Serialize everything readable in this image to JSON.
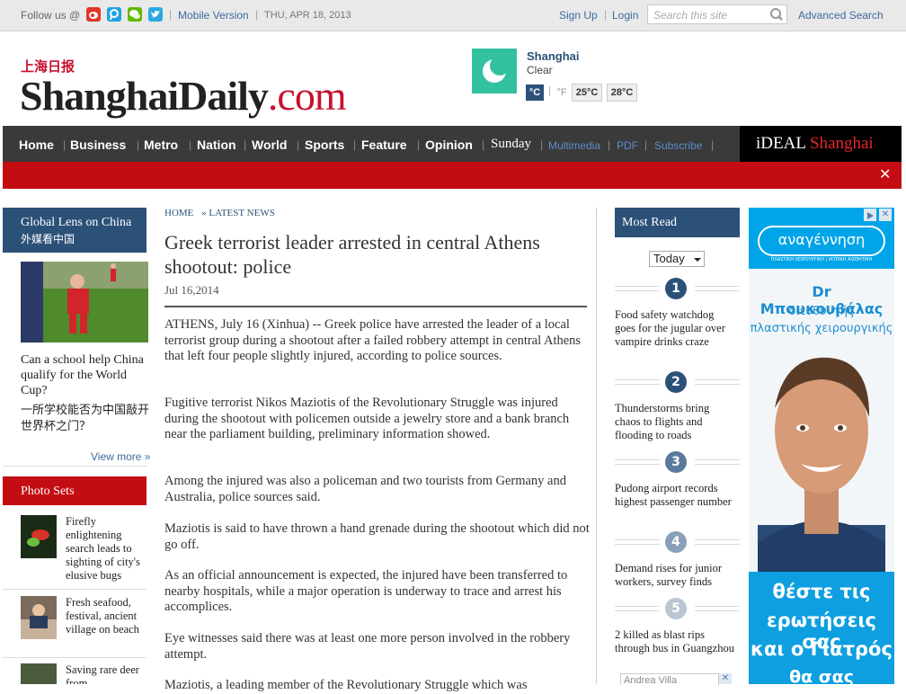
{
  "topbar": {
    "follow_label": "Follow us @",
    "social_icons": [
      {
        "name": "weibo-icon",
        "color": "#e0352b"
      },
      {
        "name": "tencent-weibo-icon",
        "color": "#1fa3e5"
      },
      {
        "name": "wechat-icon",
        "color": "#62b900"
      },
      {
        "name": "twitter-icon",
        "color": "#2aa9e0"
      }
    ],
    "mobile_version": "Mobile Version",
    "date": "THU, APR 18, 2013",
    "sign_up": "Sign Up",
    "login": "Login",
    "search_placeholder": "Search this site",
    "advanced_search": "Advanced Search"
  },
  "header": {
    "logo_cn": "上海日报",
    "logo_main": "ShanghaiDaily",
    "logo_suffix": ".com",
    "weather": {
      "city": "Shanghai",
      "condition": "Clear",
      "unit_c": "°C",
      "unit_f": "°F",
      "temp_low": "25°C",
      "temp_high": "28°C"
    }
  },
  "nav": {
    "items": [
      "Home",
      "Business",
      "Metro",
      "Nation",
      "World",
      "Sports",
      "Feature",
      "Opinion",
      "Sunday"
    ],
    "small_items": [
      "Multimedia",
      "PDF",
      "Subscribe"
    ],
    "promo_ideal": "iDEAL",
    "promo_shanghai": "Shanghai",
    "close_symbol": "✕"
  },
  "left": {
    "global_lens_title_en": "Global Lens on China",
    "global_lens_title_cn": "外媒看中国",
    "global_lens_headline": "Can a school help China qualify for the World Cup?",
    "global_lens_headline_cn": "一所学校能否为中国敲开世界杯之门？",
    "view_more": "View more »",
    "photo_sets_title": "Photo Sets",
    "photo_sets": [
      "Firefly enlightening search leads to sighting of city's elusive bugs",
      "Fresh seafood, festival, ancient village on beach",
      "Saving rare deer from"
    ]
  },
  "article": {
    "breadcrumb_home": "HOME",
    "breadcrumb_sep": "»",
    "breadcrumb_section": "LATEST NEWS",
    "title": "Greek terrorist leader arrested in central Athens shootout: police",
    "date": "Jul 16,2014",
    "paragraphs": [
      "ATHENS, July 16 (Xinhua) -- Greek police have arrested the leader of a local terrorist group during a shootout after a failed robbery attempt in central Athens that left four people slightly injured, according to police sources.",
      "Fugitive terrorist Nikos Maziotis of the Revolutionary Struggle was injured during the shootout with policemen outside a jewelry store and a bank branch near the parliament building, preliminary information showed.",
      "Among the injured was also a policeman and two tourists from Germany and Australia, police sources said.",
      "Maziotis is said to have thrown a hand grenade during the shootout which did not go off.",
      "As an official announcement is expected, the injured have been transferred to nearby hospitals, while a major operation is underway to trace and arrest his accomplices.",
      "Eye witnesses said there was at least one more person involved in the robbery attempt.",
      "Maziotis, a leading member of the Revolutionary Struggle which was"
    ]
  },
  "most_read": {
    "title": "Most Read",
    "period": "Today",
    "items": [
      {
        "rank": "1",
        "headline": "Food safety watchdog goes for the jugular over vampire drinks craze"
      },
      {
        "rank": "2",
        "headline": "Thunderstorms bring chaos to flights and flooding to roads"
      },
      {
        "rank": "3",
        "headline": "Pudong airport records highest passenger number"
      },
      {
        "rank": "4",
        "headline": "Demand rises for junior workers, survey finds"
      },
      {
        "rank": "5",
        "headline": "2 killed as blast rips through bus in Guangzhou"
      }
    ],
    "bottom_ad_text": "Andrea Villa"
  },
  "ad": {
    "brand": "αναγέννηση",
    "brand_sub": "ΠΛΑΣΤΙΚΗ ΧΕΙΡΟΥΡΓΙΚΗ | ΙΑΤΡΙΚΗ ΑΙΣΘΗΤΙΚΗ",
    "doctor": "Dr Μπουκουβάλας",
    "role_line1": "διευθυντής",
    "role_line2": "πλαστικής χειρουργικής",
    "cta": [
      "θέστε τις",
      "ερωτήσεις σας",
      "και ο Γιατρός",
      "θα σας απαντήσει"
    ]
  }
}
